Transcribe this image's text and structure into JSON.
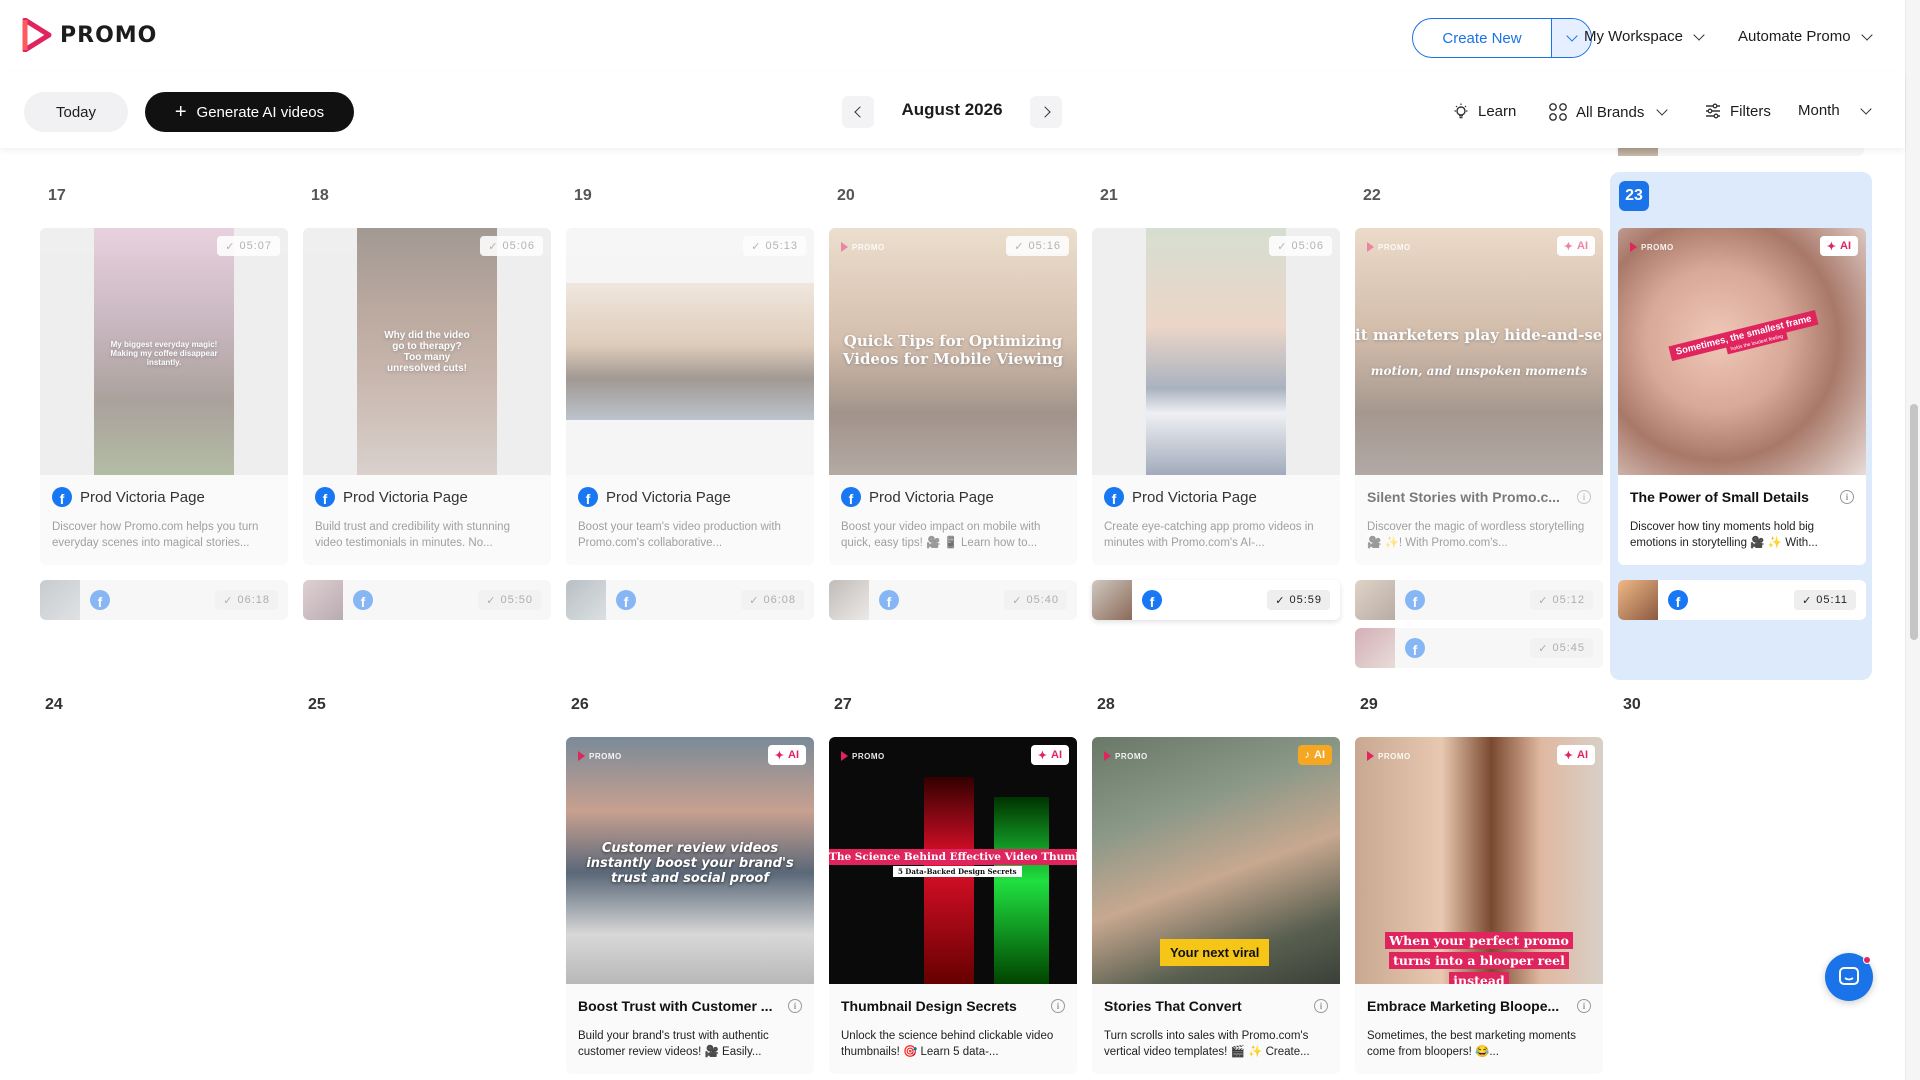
{
  "header": {
    "logo_text": "PROMO",
    "create_new": "Create New",
    "workspace": "My Workspace",
    "automate": "Automate Promo"
  },
  "toolbar": {
    "today": "Today",
    "generate": "Generate AI videos",
    "month_title": "August 2026",
    "learn": "Learn",
    "brands": "All Brands",
    "filters": "Filters",
    "view": "Month"
  },
  "calendar": {
    "week1": {
      "days": [
        "17",
        "18",
        "19",
        "20",
        "21",
        "22",
        "23"
      ],
      "cards": [
        {
          "page": "Prod Victoria Page",
          "duration": "05:07",
          "desc": "Discover how Promo.com helps you turn everyday scenes into magical stories...",
          "caption": "My biggest everyday magic! Making my coffee disappear instantly.",
          "sub_duration": "06:18"
        },
        {
          "page": "Prod Victoria Page",
          "duration": "05:06",
          "desc": "Build trust and credibility with stunning video testimonials in minutes. No...",
          "caption": "Why did the video go to therapy? Too many unresolved cuts!",
          "sub_duration": "05:50"
        },
        {
          "page": "Prod Victoria Page",
          "duration": "05:13",
          "desc": "Boost your team's video production with Promo.com's collaborative...",
          "caption": "",
          "sub_duration": "06:08"
        },
        {
          "page": "Prod Victoria Page",
          "duration": "05:16",
          "desc": "Boost your video impact on mobile with quick, easy tips! 🎥 📱 Learn how to...",
          "caption": "Quick Tips for Optimizing Videos for Mobile Viewing",
          "sub_duration": "05:40"
        },
        {
          "page": "Prod Victoria Page",
          "duration": "05:06",
          "desc": "Create eye-catching app promo videos in minutes with Promo.com's AI-...",
          "caption": "",
          "sub_duration": "05:59"
        },
        {
          "title": "Silent Stories with Promo.c...",
          "ai": "AI",
          "desc": "Discover the magic of wordless storytelling 🎥 ✨! With Promo.com's...",
          "caption": "it marketers play hide-and-seek? ck hiding when you're always tr",
          "caption2": "motion, and unspoken moments",
          "sub_duration": "05:12",
          "sub_duration2": "05:45"
        },
        {
          "title": "The Power of Small Details",
          "ai": "AI",
          "desc": "Discover how tiny moments hold big emotions in storytelling 🎥 ✨ With...",
          "caption": "Sometimes, the smallest frame",
          "caption2": "holds the loudest feeling",
          "sub_duration": "05:11"
        }
      ]
    },
    "week2": {
      "days": [
        "24",
        "25",
        "26",
        "27",
        "28",
        "29",
        "30"
      ],
      "cards": [
        {
          "title": "Boost Trust with Customer ...",
          "ai": "AI",
          "desc": "Build your brand's trust with authentic customer review videos! 🎥 Easily...",
          "caption": "Customer review videos instantly boost your brand's trust and social proof"
        },
        {
          "title": "Thumbnail Design Secrets",
          "ai": "AI",
          "desc": "Unlock the science behind clickable video thumbnails! 🎯 Learn 5 data-...",
          "caption": "The Science Behind Effective Video Thumbnails",
          "caption2": "5 Data-Backed Design Secrets"
        },
        {
          "title": "Stories That Convert",
          "ai": "AI",
          "desc": "Turn scrolls into sales with Promo.com's vertical video templates! 🎬 ✨ Create...",
          "caption": "Your next viral"
        },
        {
          "title": "Embrace Marketing Bloope...",
          "ai": "AI",
          "desc": "Sometimes, the best marketing moments come from bloopers! 😂...",
          "caption": "When your perfect promo turns into a blooper reel instead"
        }
      ]
    },
    "brand_tag": "PROMO"
  },
  "colors": {
    "accent": "#1a73e8",
    "brand_pink": "#e0245e",
    "today_bg": "#dceafb",
    "facebook": "#1877f2"
  },
  "icons": {
    "learn": "lightbulb-icon",
    "brands": "grid-circles-icon",
    "filters": "sliders-icon",
    "chat": "chat-bubble-icon"
  }
}
